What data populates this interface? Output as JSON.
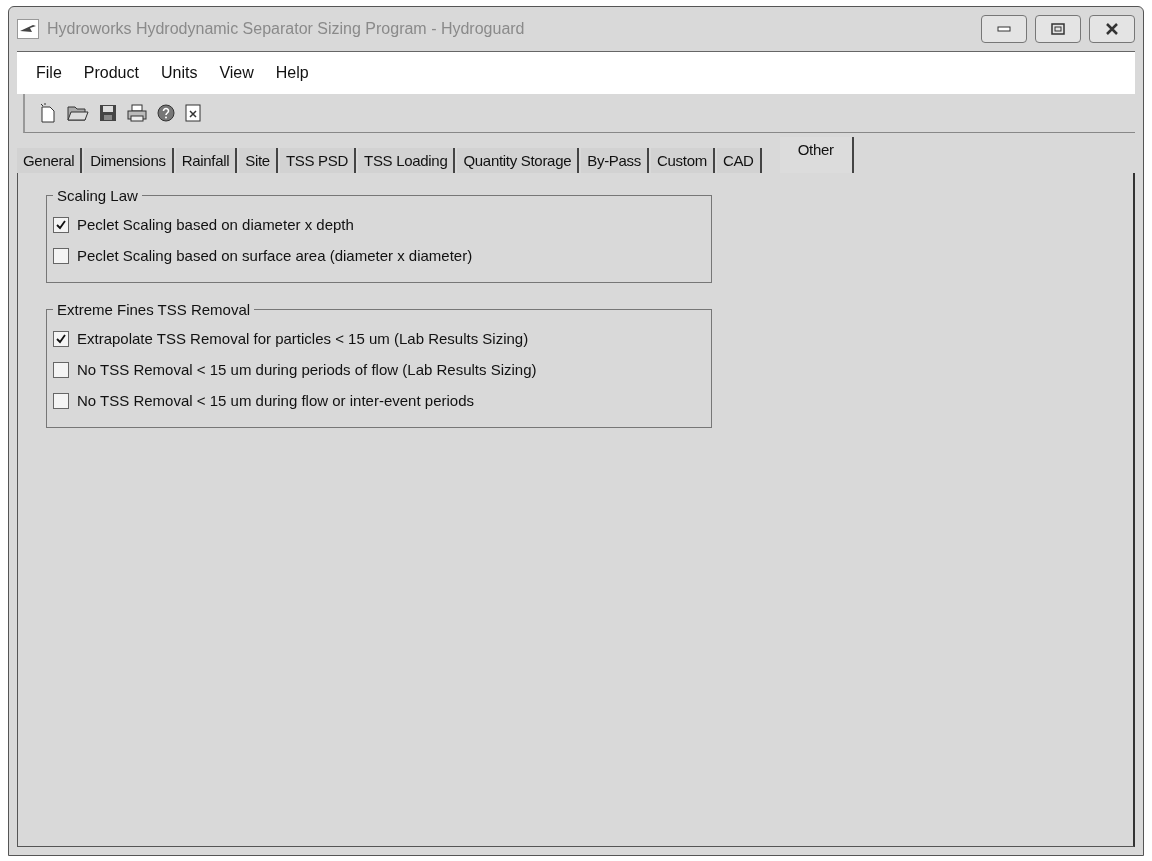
{
  "window": {
    "title": "Hydroworks Hydrodynamic Separator Sizing Program - Hydroguard"
  },
  "menu": [
    "File",
    "Product",
    "Units",
    "View",
    "Help"
  ],
  "toolbar": [
    {
      "kind": "new"
    },
    {
      "kind": "open"
    },
    {
      "kind": "save"
    },
    {
      "kind": "print"
    },
    {
      "kind": "help"
    },
    {
      "kind": "close"
    }
  ],
  "tabs": [
    {
      "label": "General",
      "selected": false
    },
    {
      "label": "Dimensions",
      "selected": false
    },
    {
      "label": "Rainfall",
      "selected": false
    },
    {
      "label": "Site",
      "selected": false
    },
    {
      "label": "TSS PSD",
      "selected": false
    },
    {
      "label": "TSS Loading",
      "selected": false
    },
    {
      "label": "Quantity Storage",
      "selected": false
    },
    {
      "label": "By-Pass",
      "selected": false
    },
    {
      "label": "Custom",
      "selected": false
    },
    {
      "label": "CAD",
      "selected": false
    },
    {
      "label": "Other",
      "selected": true
    }
  ],
  "groups": [
    {
      "title": "Scaling Law",
      "options": [
        {
          "label": "Peclet Scaling based on diameter x depth",
          "checked": true
        },
        {
          "label": "Peclet Scaling based on surface area (diameter x diameter)",
          "checked": false
        }
      ]
    },
    {
      "title": "Extreme Fines TSS Removal",
      "options": [
        {
          "label": "Extrapolate TSS Removal for particles < 15 um (Lab Results Sizing)",
          "checked": true
        },
        {
          "label": "No TSS Removal < 15 um during periods of flow (Lab Results Sizing)",
          "checked": false
        },
        {
          "label": "No TSS Removal < 15 um during flow or inter-event periods",
          "checked": false
        }
      ]
    }
  ]
}
